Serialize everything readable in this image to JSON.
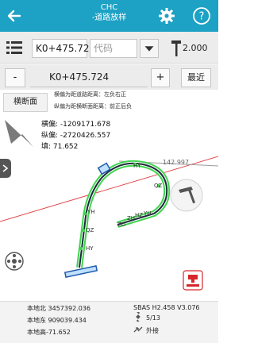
{
  "header": {
    "app": "CHC",
    "title": "-道路放样"
  },
  "toolbar": {
    "pile_value": "K0+475.72",
    "code_placeholder": "代码",
    "antenna_height": "2.000"
  },
  "station": {
    "minus": "-",
    "value": "K0+475.724",
    "plus": "+",
    "nearest": "最近"
  },
  "info": {
    "section_button": "横断面",
    "rule_line1": "横偏为距道路距离：左负右正",
    "rule_line2": "纵偏为距横断面距离：前正后负",
    "offset_label": "横偏: -1209171.678",
    "longitudinal_label": "纵偏: -2720426.557",
    "fill_label": "填: 71.652"
  },
  "map": {
    "labels": {
      "hy_top": "HY",
      "distance": "142.997",
      "qz_right": "QZ",
      "yh_left": "YH",
      "zh": "ZH",
      "hz": "HZ",
      "yh_right": "YH",
      "zd": "ZD",
      "qz_left": "QZ",
      "hy_bottom": "HY"
    }
  },
  "status": {
    "north": "本地北 3457392.036",
    "east": "本地东 909039.434",
    "elev": "本地高-71.652",
    "sbas": "SBAS H2.458 V3.076",
    "satellites": "5/13",
    "mode": "外接"
  },
  "colors": {
    "header": "#1da1c4",
    "road": "#1e5aa8",
    "road_edge": "#3fd44d",
    "reference_line": "#e0484b",
    "stake": "#d8262c"
  }
}
